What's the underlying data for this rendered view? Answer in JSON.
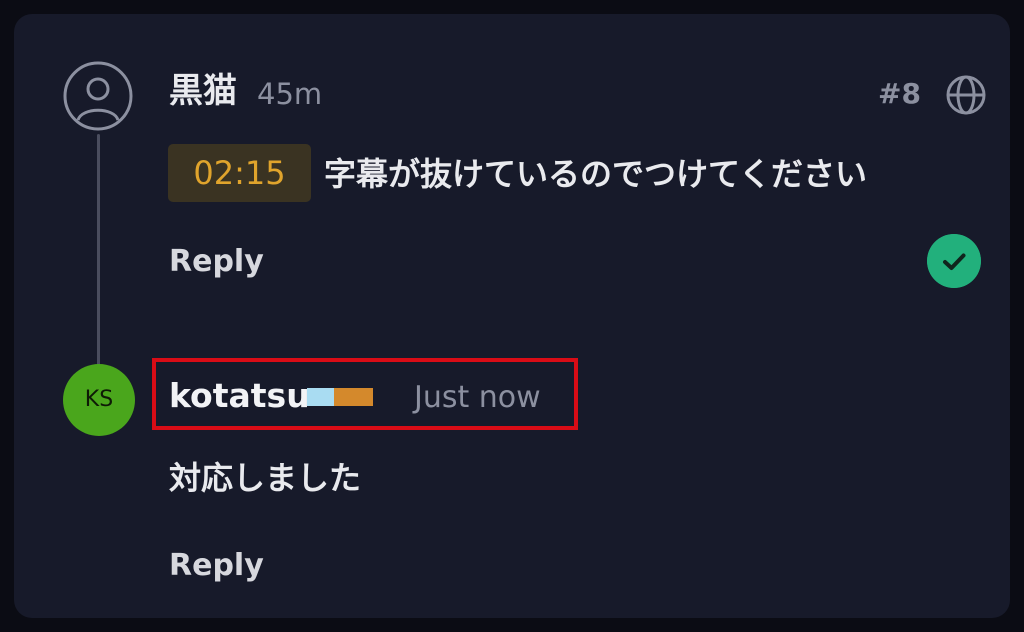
{
  "comments": [
    {
      "author": "黒猫",
      "time": "45m",
      "number": "#8",
      "timestamp": "02:15",
      "text": "字幕が抜けているのでつけてください",
      "reply_label": "Reply",
      "avatar_icon": "user-circle-icon",
      "visibility_icon": "globe-icon",
      "resolved_icon": "check-circle-icon",
      "resolved_color": "#22b07c",
      "timestamp_color": "#e0a42c"
    },
    {
      "author": "kotatsu",
      "initials": "KS",
      "time": "Just now",
      "text": "対応しました",
      "reply_label": "Reply",
      "avatar_color": "#4aa61c",
      "badge_colors": [
        "#a9dcf2",
        "#d4892c"
      ]
    }
  ],
  "highlight_color": "#d90c16"
}
